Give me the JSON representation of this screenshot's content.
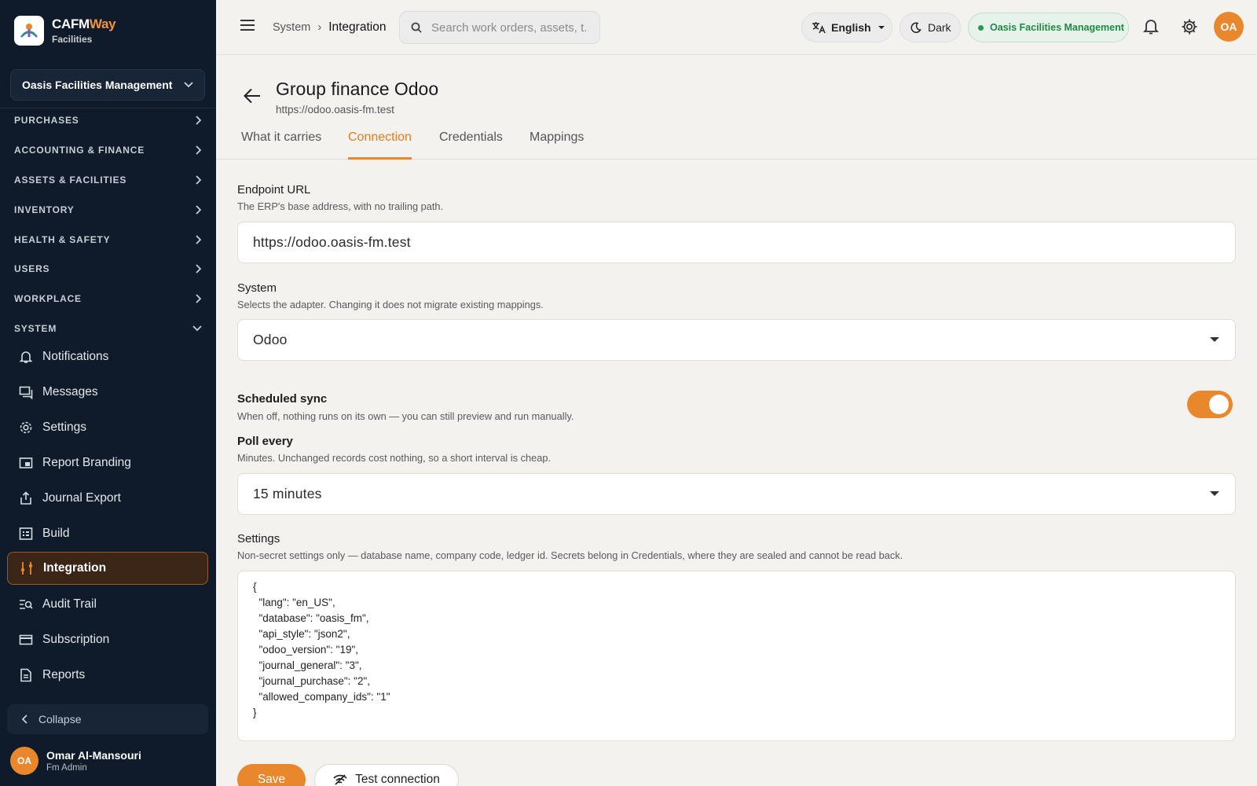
{
  "brand": {
    "name_main": "CAFM",
    "name_accent": "Way",
    "subtitle": "Facilities"
  },
  "sidebar": {
    "org": "Oasis Facilities Management",
    "sections": [
      {
        "label": "PURCHASES",
        "state": "collapsed"
      },
      {
        "label": "ACCOUNTING & FINANCE",
        "state": "collapsed"
      },
      {
        "label": "ASSETS & FACILITIES",
        "state": "collapsed"
      },
      {
        "label": "INVENTORY",
        "state": "collapsed"
      },
      {
        "label": "HEALTH & SAFETY",
        "state": "collapsed"
      },
      {
        "label": "USERS",
        "state": "collapsed"
      },
      {
        "label": "WORKPLACE",
        "state": "collapsed"
      },
      {
        "label": "SYSTEM",
        "state": "expanded"
      }
    ],
    "items": [
      {
        "label": "Notifications",
        "icon": "bell-icon"
      },
      {
        "label": "Messages",
        "icon": "chat-icon"
      },
      {
        "label": "Settings",
        "icon": "gear-icon"
      },
      {
        "label": "Report Branding",
        "icon": "branding-icon"
      },
      {
        "label": "Journal Export",
        "icon": "export-icon"
      },
      {
        "label": "Build",
        "icon": "build-icon"
      },
      {
        "label": "Integration",
        "icon": "integration-icon",
        "active": true
      },
      {
        "label": "Audit Trail",
        "icon": "audit-icon"
      },
      {
        "label": "Subscription",
        "icon": "card-icon"
      },
      {
        "label": "Reports",
        "icon": "report-icon"
      }
    ],
    "collapse_label": "Collapse",
    "user": {
      "initials": "OA",
      "name": "Omar Al-Mansouri",
      "role": "Fm Admin"
    }
  },
  "topbar": {
    "breadcrumb": [
      "System",
      "Integration"
    ],
    "search_placeholder": "Search work orders, assets, t...",
    "language": "English",
    "theme": "Dark",
    "org_badge": "Oasis Facilities Management",
    "avatar_initials": "OA",
    "accent_color": "#e8872c"
  },
  "page": {
    "title": "Group finance Odoo",
    "subtitle": "https://odoo.oasis-fm.test",
    "tabs": [
      "What it carries",
      "Connection",
      "Credentials",
      "Mappings"
    ],
    "active_tab": "Connection"
  },
  "form": {
    "endpoint": {
      "label": "Endpoint URL",
      "help": "The ERP's base address, with no trailing path.",
      "value": "https://odoo.oasis-fm.test"
    },
    "system": {
      "label": "System",
      "help": "Selects the adapter. Changing it does not migrate existing mappings.",
      "value": "Odoo"
    },
    "scheduled_sync": {
      "label": "Scheduled sync",
      "help": "When off, nothing runs on its own — you can still preview and run manually.",
      "enabled": true
    },
    "poll": {
      "label": "Poll every",
      "help": "Minutes. Unchanged records cost nothing, so a short interval is cheap.",
      "value": "15 minutes"
    },
    "settings": {
      "label": "Settings",
      "help": "Non-secret settings only — database name, company code, ledger id. Secrets belong in Credentials, where they are sealed and cannot be read back.",
      "value": "{\n  \"lang\": \"en_US\",\n  \"database\": \"oasis_fm\",\n  \"api_style\": \"json2\",\n  \"odoo_version\": \"19\",\n  \"journal_general\": \"3\",\n  \"journal_purchase\": \"2\",\n  \"allowed_company_ids\": \"1\"\n}"
    },
    "save_label": "Save",
    "test_label": "Test connection"
  }
}
